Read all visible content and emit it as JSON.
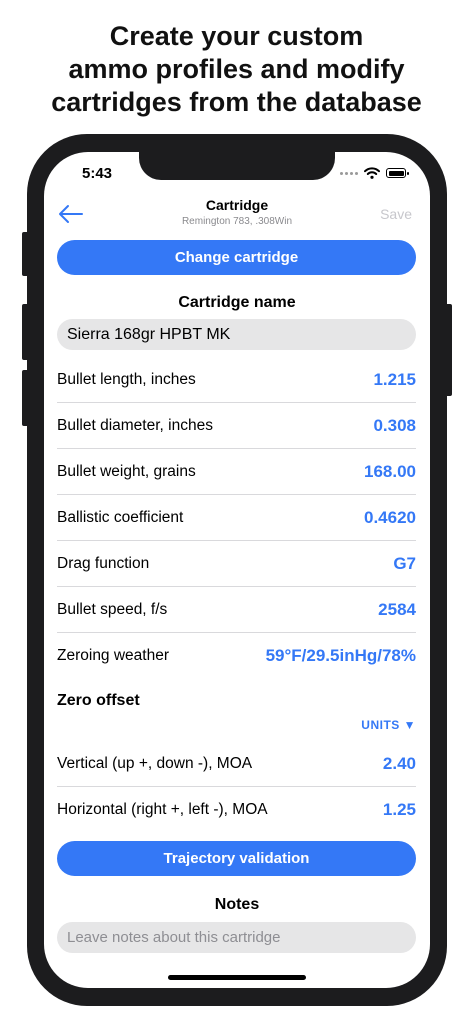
{
  "promo": {
    "line1": "Create your custom",
    "line2": "ammo profiles and modify",
    "line3": "cartridges from the database"
  },
  "status_bar": {
    "time": "5:43",
    "icons": [
      "cellular-dots-icon",
      "wifi-icon",
      "battery-icon"
    ]
  },
  "nav": {
    "back_icon": "arrow-left-icon",
    "title": "Cartridge",
    "subtitle": "Remington 783, .308Win",
    "save_label": "Save"
  },
  "change_cartridge_label": "Change cartridge",
  "cartridge_name": {
    "title": "Cartridge name",
    "value": "Sierra 168gr HPBT MK"
  },
  "rows": [
    {
      "label": "Bullet length, inches",
      "value": "1.215"
    },
    {
      "label": "Bullet diameter, inches",
      "value": "0.308"
    },
    {
      "label": "Bullet weight, grains",
      "value": "168.00"
    },
    {
      "label": "Ballistic coefficient",
      "value": "0.4620"
    },
    {
      "label": "Drag function",
      "value": "G7"
    },
    {
      "label": "Bullet speed, f/s",
      "value": "2584"
    },
    {
      "label": "Zeroing weather",
      "value": "59°F/29.5inHg/78%"
    }
  ],
  "zero_offset": {
    "title": "Zero offset",
    "units_label": "UNITS ▼",
    "rows": [
      {
        "label": "Vertical (up +, down -), MOA",
        "value": "2.40"
      },
      {
        "label": "Horizontal (right +, left -), MOA",
        "value": "1.25"
      }
    ]
  },
  "trajectory_label": "Trajectory validation",
  "notes": {
    "title": "Notes",
    "placeholder": "Leave notes about this cartridge"
  },
  "colors": {
    "accent": "#3478f6",
    "frame": "#1c1c1e",
    "field_bg": "#e6e6e7",
    "disabled": "#c7c7cc"
  }
}
